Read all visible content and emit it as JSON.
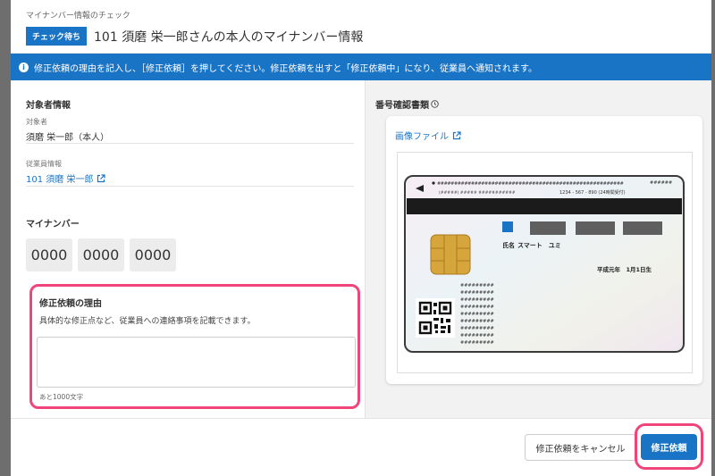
{
  "header": {
    "breadcrumb": "マイナンバー情報のチェック",
    "badge": "チェック待ち",
    "title": "101 須磨 栄一郎さんの本人のマイナンバー情報"
  },
  "banner": {
    "text": "修正依頼の理由を記入し、［修正依頼］を押してください。修正依頼を出すと「修正依頼中」になり、従業員へ通知されます。"
  },
  "subject": {
    "section_title": "対象者情報",
    "person_label": "対象者",
    "person_value": "須磨 栄一郎（本人）",
    "employee_label": "従業員情報",
    "employee_link": "101 須磨 栄一郎"
  },
  "mynumber": {
    "section_title": "マイナンバー",
    "groups": [
      "0000",
      "0000",
      "0000"
    ]
  },
  "reason": {
    "title": "修正依頼の理由",
    "description": "具体的な修正点など、従業員への連絡事項を記載できます。",
    "value": "",
    "counter": "あと1000文字"
  },
  "document": {
    "section_title": "番号確認書類",
    "image_link": "画像ファイル",
    "card": {
      "code_line": "1234 - 567 - 890 (24時間受付)",
      "name_label": "氏名",
      "name_value": "スマート　ユミ",
      "birth_date": "平成元年　1月1日生"
    }
  },
  "footer": {
    "cancel_label": "修正依頼をキャンセル",
    "submit_label": "修正依頼"
  },
  "colors": {
    "primary": "#1a74c6",
    "highlight": "#f0457a",
    "overlay": "#6e6e6e"
  }
}
